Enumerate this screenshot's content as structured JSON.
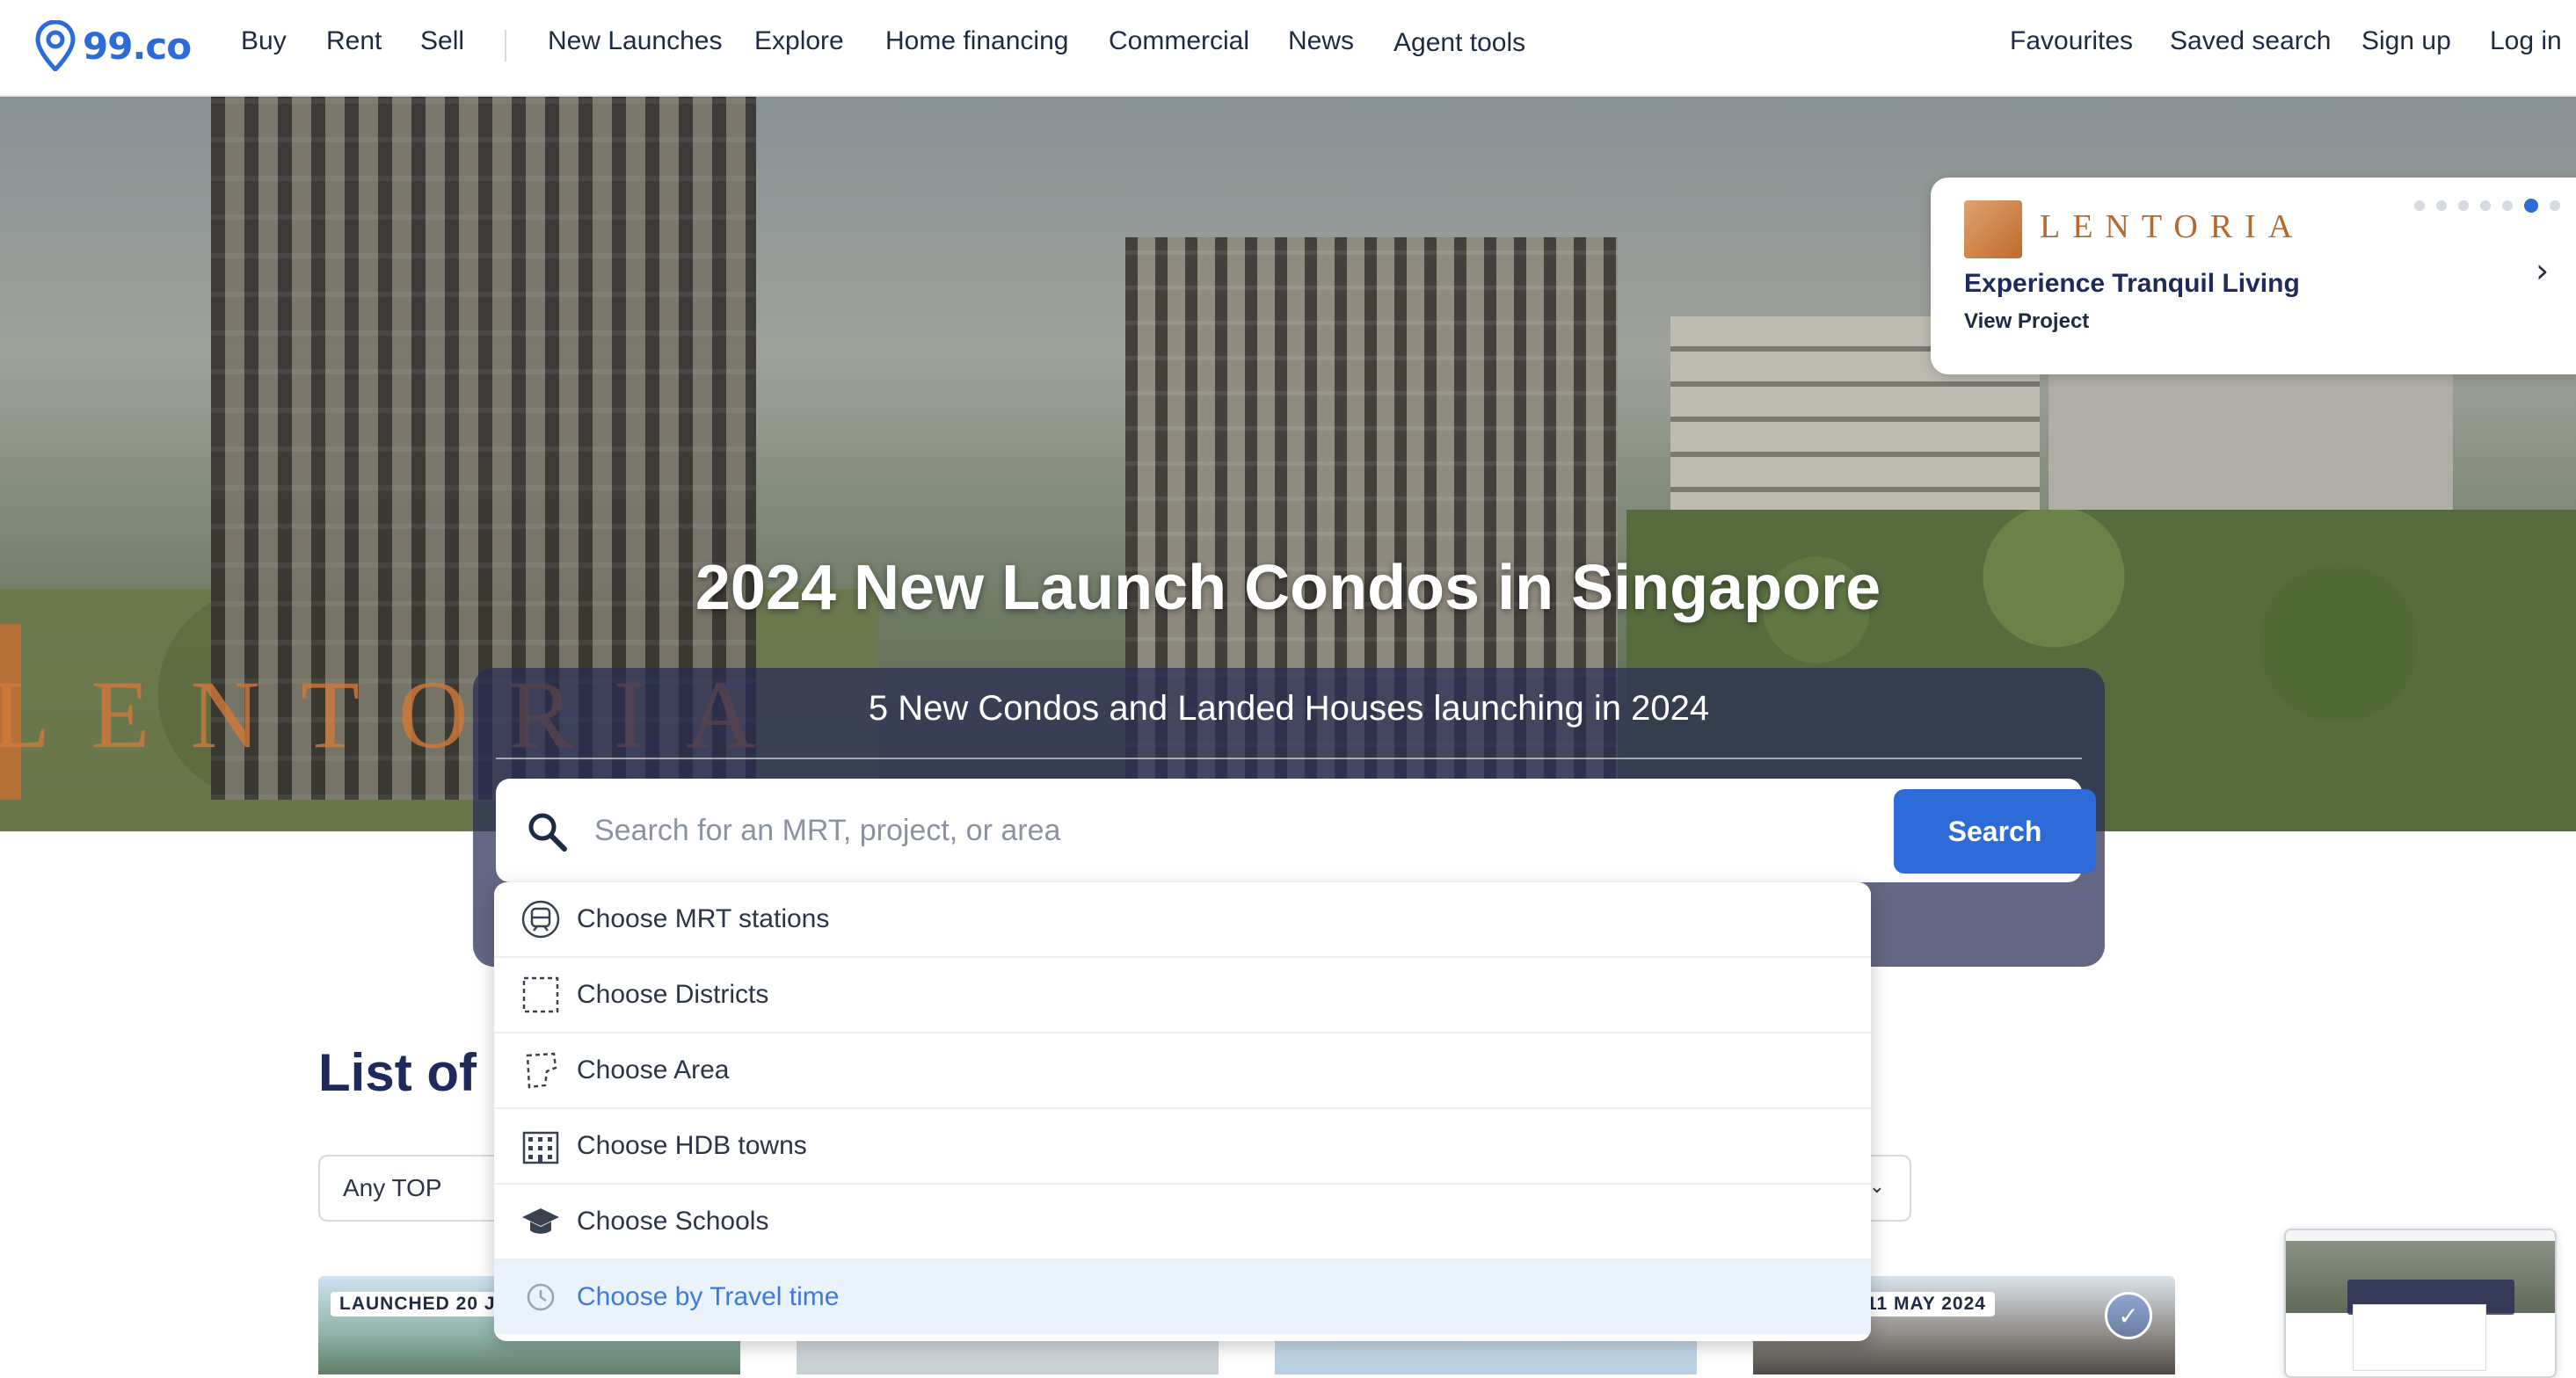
{
  "nav": {
    "logo_text": "99.co",
    "left": [
      "Buy",
      "Rent",
      "Sell"
    ],
    "middle": [
      "New Launches",
      "Explore",
      "Home financing",
      "Commercial",
      "News",
      "Agent tools"
    ],
    "right": [
      "Favourites",
      "Saved search",
      "Sign up",
      "Log in"
    ]
  },
  "promo": {
    "brand": "LENTORIA",
    "title": "Experience Tranquil Living",
    "link": "View Project",
    "slides": 7,
    "active_slide": 5
  },
  "hero": {
    "watermark": "LENTORIA",
    "title": "2024 New Launch Condos in Singapore",
    "subtitle": "5 New Condos and Landed Houses launching in 2024"
  },
  "search": {
    "placeholder": "Search for an MRT, project, or area",
    "button": "Search"
  },
  "dropdown": {
    "items": [
      {
        "label": "Choose MRT stations",
        "icon": "train-icon"
      },
      {
        "label": "Choose Districts",
        "icon": "dashed-square-icon"
      },
      {
        "label": "Choose Area",
        "icon": "area-outline-icon"
      },
      {
        "label": "Choose HDB towns",
        "icon": "building-icon"
      },
      {
        "label": "Choose Schools",
        "icon": "graduation-cap-icon"
      },
      {
        "label": "Choose by Travel time",
        "icon": "clock-icon",
        "highlighted": true
      }
    ]
  },
  "listing": {
    "title_visible": "List of N",
    "filter_top": "Any TOP"
  },
  "cards": [
    {
      "tag": "LAUNCHED 20 JU"
    },
    {
      "tag": ""
    },
    {
      "tag": ""
    },
    {
      "tag": "D 11 MAY 2024"
    }
  ],
  "colors": {
    "brand_blue": "#2d6bd9",
    "panel": "#282d55",
    "highlight": "#eaf2fb",
    "lentoria_orange": "#c16a2c"
  }
}
